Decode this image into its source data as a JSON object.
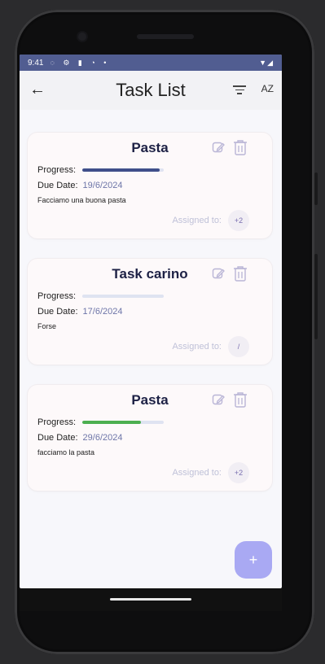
{
  "status": {
    "time": "9:41",
    "icons": "◌ ⚙ ▮ ◔ •",
    "right": "▼◢"
  },
  "header": {
    "title": "Task List",
    "back_icon": "arrow-left-icon",
    "filter_icon": "filter-icon",
    "sort_label": "AZ"
  },
  "labels": {
    "progress": "Progress:",
    "due_date": "Due Date:",
    "assigned_to": "Assigned to:"
  },
  "tasks": [
    {
      "name": "Pasta",
      "progress": 0.95,
      "progress_color": "#3f4f8a",
      "due": "19/6/2024",
      "description": "Facciamo una buona pasta",
      "assigned": "+2"
    },
    {
      "name": "Task carino",
      "progress": 0.0,
      "progress_color": "#3f4f8a",
      "due": "17/6/2024",
      "description": "Forse",
      "assigned": "/"
    },
    {
      "name": "Pasta",
      "progress": 0.72,
      "progress_color": "#4caf50",
      "due": "29/6/2024",
      "description": "facciamo la pasta",
      "assigned": "+2"
    }
  ],
  "fab": {
    "label": "+"
  },
  "colors": {
    "accent": "#a9a9f3",
    "statusbar": "#515d91"
  }
}
